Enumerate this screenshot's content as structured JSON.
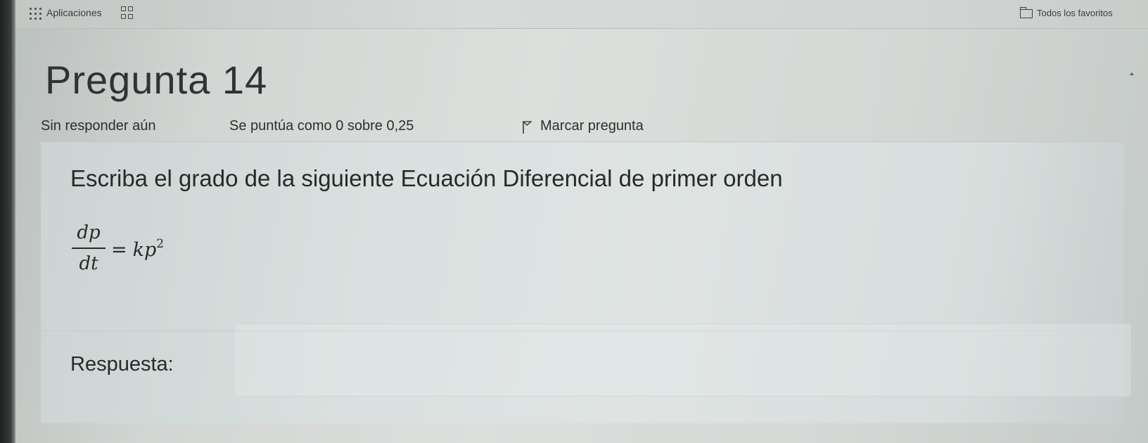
{
  "bookmarks_bar": {
    "apps_label": "Aplicaciones",
    "favorites_label": "Todos los favoritos",
    "icons": [
      "apps-grid-icon",
      "tab-grid-icon",
      "folder-icon"
    ]
  },
  "question": {
    "title": "Pregunta 14",
    "status": "Sin responder aún",
    "grade": "Se puntúa como 0 sobre 0,25",
    "flag_label": "Marcar pregunta",
    "flag_icon": "flag-icon",
    "prompt": "Escriba el grado de la siguiente Ecuación Diferencial de primer orden",
    "equation": {
      "numerator": "dp",
      "denominator": "dt",
      "equals": "=",
      "rhs_base": "kp",
      "rhs_exponent": "2"
    },
    "answer_label": "Respuesta:",
    "answer_value": ""
  },
  "colors": {
    "text": "#262a29",
    "content_bg": "#dfe4e3"
  }
}
